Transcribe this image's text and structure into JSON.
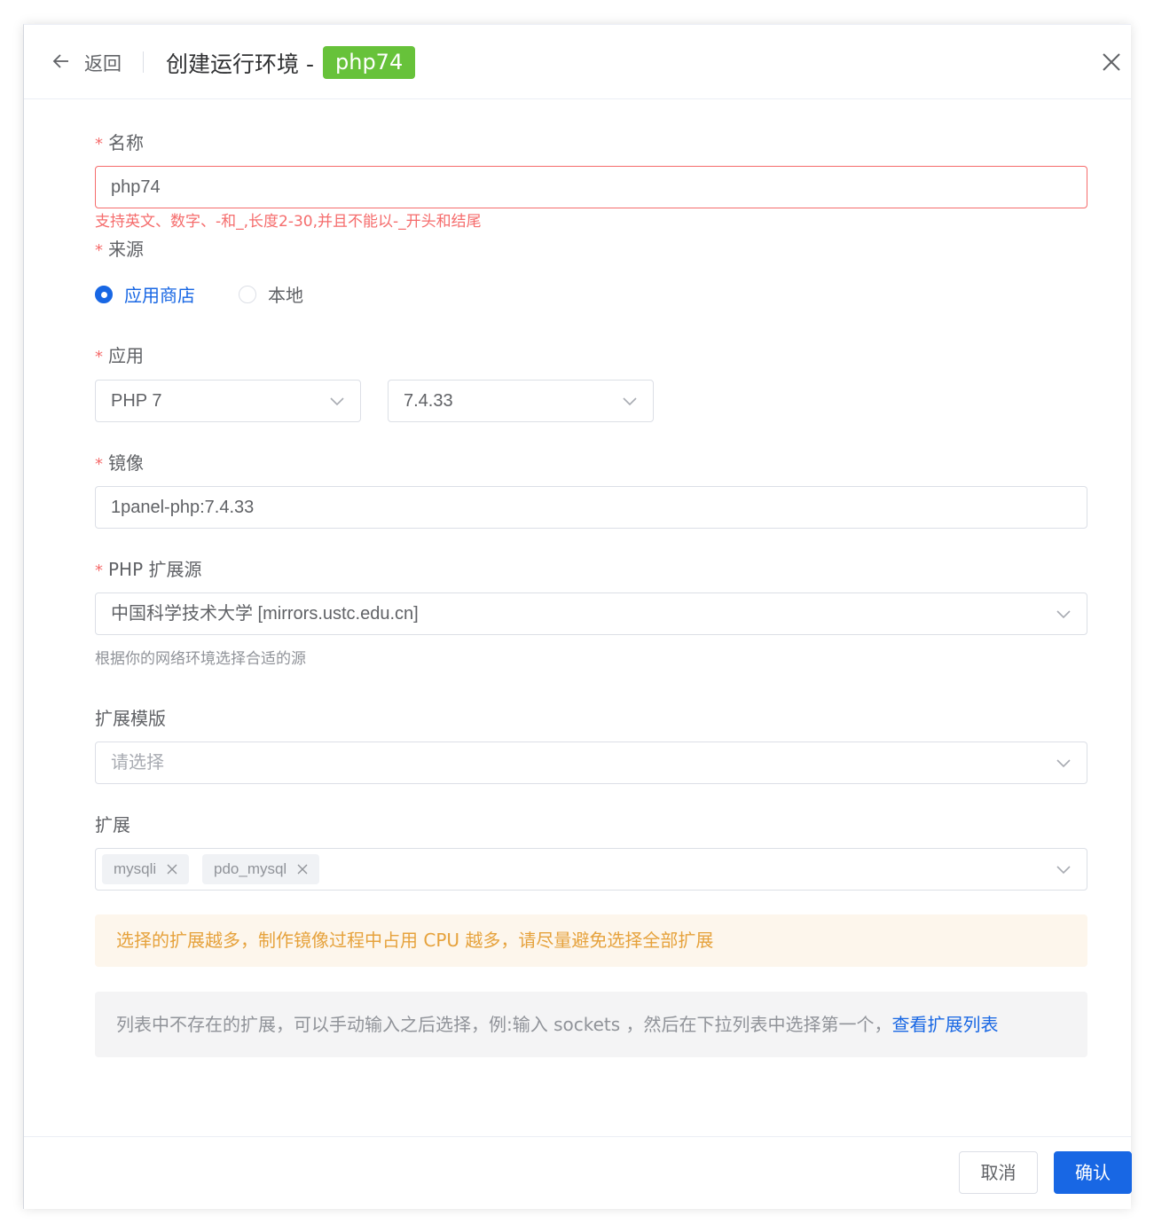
{
  "header": {
    "back_label": "返回",
    "title": "创建运行环境 -",
    "tag": "php74"
  },
  "form": {
    "name": {
      "label": "名称",
      "value": "php74",
      "error": "支持英文、数字、-和_,长度2-30,并且不能以-_开头和结尾"
    },
    "source": {
      "label": "来源",
      "options": [
        {
          "label": "应用商店",
          "checked": true
        },
        {
          "label": "本地",
          "checked": false
        }
      ]
    },
    "app": {
      "label": "应用",
      "app_value": "PHP 7",
      "version_value": "7.4.33"
    },
    "image": {
      "label": "镜像",
      "value": "1panel-php:7.4.33"
    },
    "ext_source": {
      "label": "PHP 扩展源",
      "value": "中国科学技术大学 [mirrors.ustc.edu.cn]",
      "help": "根据你的网络环境选择合适的源"
    },
    "ext_template": {
      "label": "扩展模版",
      "placeholder": "请选择"
    },
    "extensions": {
      "label": "扩展",
      "tags": [
        "mysqli",
        "pdo_mysql"
      ]
    }
  },
  "alerts": {
    "warning": "选择的扩展越多，制作镜像过程中占用 CPU 越多，请尽量避免选择全部扩展",
    "info": "列表中不存在的扩展，可以手动输入之后选择，例:输入 sockets ，然后在下拉列表中选择第一个，",
    "info_link": "查看扩展列表"
  },
  "footer": {
    "cancel": "取消",
    "confirm": "确认"
  },
  "colors": {
    "primary": "#1867e4",
    "success_tag": "#67c23a",
    "danger": "#f56c6c",
    "warning": "#e6a23c"
  }
}
